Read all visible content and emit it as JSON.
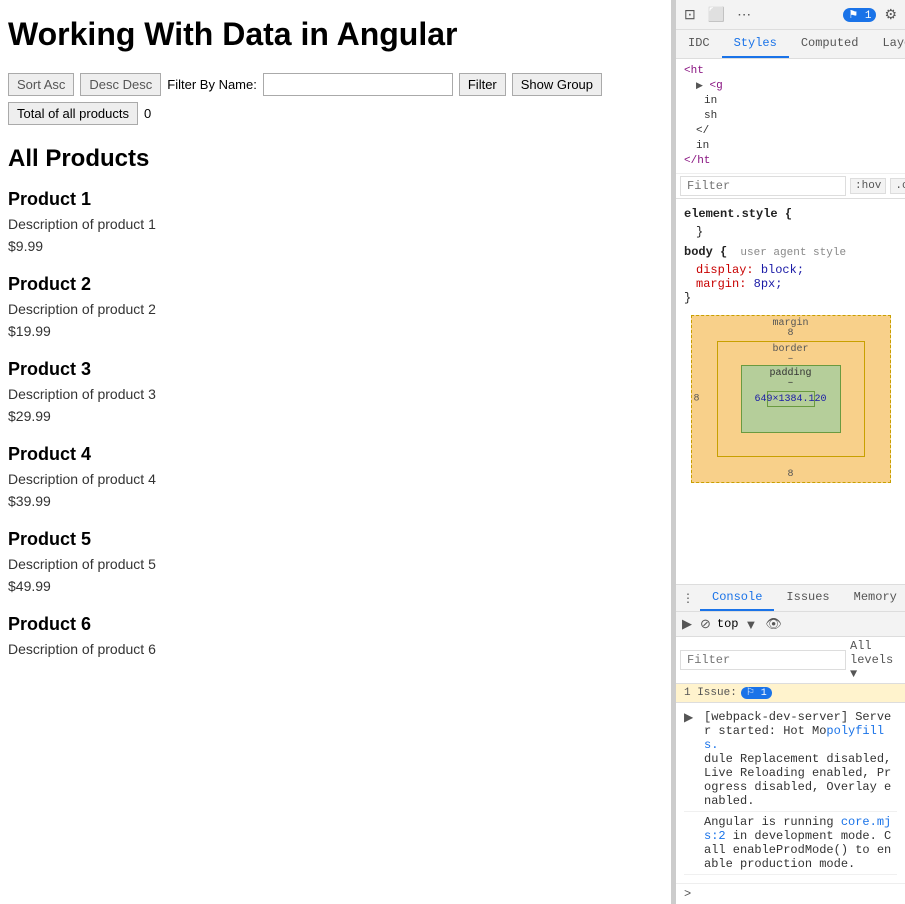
{
  "app": {
    "title": "Working With Data in Angular",
    "section_title": "All Products"
  },
  "toolbar": {
    "sort_asc_label": "Sort Asc",
    "desc_desc_label": "Desc Desc",
    "filter_by_name_label": "Filter By Name:",
    "filter_input_value": "",
    "filter_button_label": "Filter",
    "show_group_label": "Show Group",
    "total_label": "Total of all products",
    "total_count": "0"
  },
  "products": [
    {
      "name": "Product 1",
      "description": "Description of product 1",
      "price": "$9.99"
    },
    {
      "name": "Product 2",
      "description": "Description of product 2",
      "price": "$19.99"
    },
    {
      "name": "Product 3",
      "description": "Description of product 3",
      "price": "$29.99"
    },
    {
      "name": "Product 4",
      "description": "Description of product 4",
      "price": "$39.99"
    },
    {
      "name": "Product 5",
      "description": "Description of product 5",
      "price": "$49.99"
    },
    {
      "name": "Product 6",
      "description": "Description of product 6",
      "price": ""
    }
  ],
  "devtools": {
    "top_tabs": [
      "IDC",
      "Styles",
      "Computed",
      "Layout"
    ],
    "active_top_tab": "Styles",
    "filter_placeholder": "Filter",
    "filter_pseudo_hov": ":hov",
    "filter_pseudo_cls": ".cls",
    "styles": {
      "element_style": "element.style {",
      "body_selector": "body {",
      "body_comment": "user agent style",
      "body_props": [
        {
          "prop": "display:",
          "val": "block;"
        },
        {
          "prop": "margin:",
          "val": "8px;"
        }
      ],
      "body_close": "}"
    },
    "html_tree": [
      "</",
      "<g",
      "in",
      "sh",
      "</",
      "in",
      "</ht"
    ],
    "box_model": {
      "margin_label": "margin",
      "margin_val": "8",
      "border_label": "border",
      "border_val": "–",
      "padding_label": "padding",
      "padding_val": "–",
      "content_dims": "649×1384.120",
      "content_inner": "–"
    },
    "bottom_tabs": [
      "Console",
      "Issues",
      "Memory"
    ],
    "active_bottom_tab": "Console",
    "console_filter_placeholder": "Filter",
    "console_levels": "All levels",
    "top_context": "top",
    "issue_count": "1",
    "issue_label": "1 Issue:",
    "issue_badge": "⚐ 1",
    "console_messages": [
      {
        "icon": "▶",
        "text": "[webpack-dev-server] Server started: Hot Module Replacement disabled, Live Reloading enabled, Progress disabled, Overlay enabled.",
        "link": "polyfills."
      },
      {
        "icon": "",
        "text": "Angular is running ",
        "link": "core.mjs:2",
        "text2": " in development mode. Call enableProdMode() to enable production mode."
      }
    ],
    "prompt_symbol": ">"
  },
  "icons": {
    "devtools_panel": "⊞",
    "devtools_more": "⋮",
    "forward": "▶",
    "back": "◀",
    "inspect": "☰",
    "close": "✕",
    "ban": "🚫",
    "top_arrow": "▼",
    "eye": "👁",
    "chevron_right": "▶",
    "triangle_right": "▶",
    "minus": "−"
  }
}
